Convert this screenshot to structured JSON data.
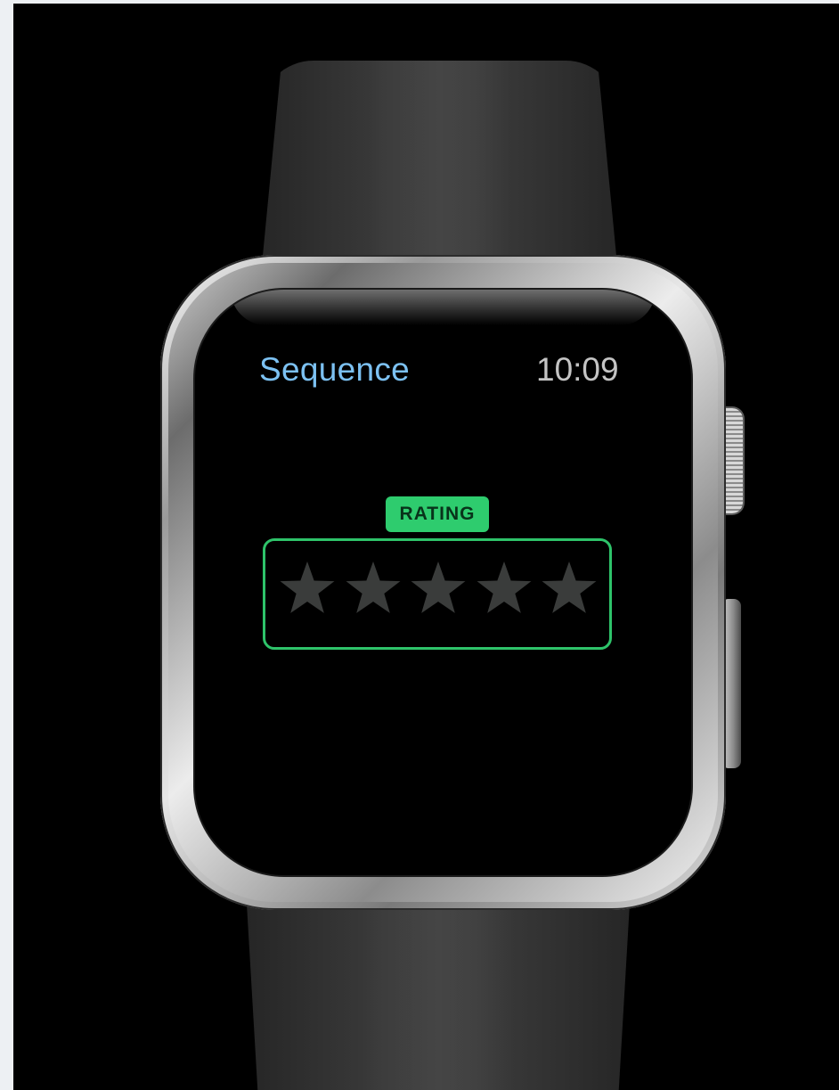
{
  "app": {
    "title": "Sequence",
    "time": "10:09"
  },
  "rating": {
    "label": "RATING",
    "value": 0,
    "max": 5
  },
  "colors": {
    "title": "#7cc1f2",
    "time": "#c4c4c4",
    "accent": "#2ecc6e",
    "star_empty": "#3a3c3b",
    "background": "#000000"
  },
  "icons": {
    "star": "star-icon"
  }
}
